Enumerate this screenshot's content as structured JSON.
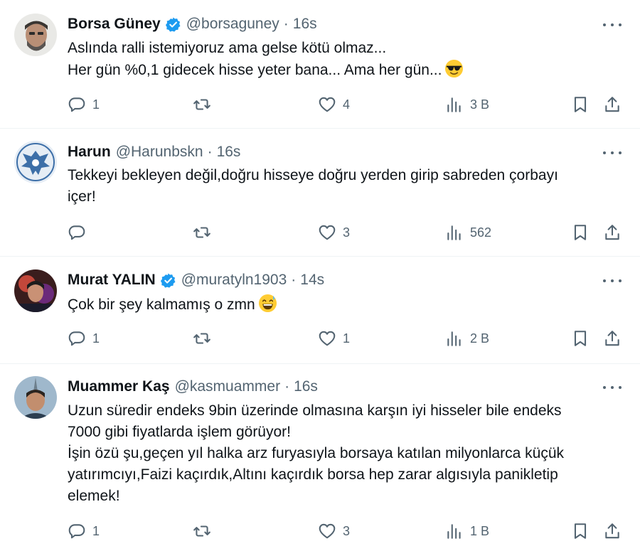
{
  "tweets": [
    {
      "name": "Borsa Güney",
      "verified": true,
      "handle": "@borsaguney",
      "time": "16s",
      "lines": [
        "Aslında ralli istemiyoruz ama gelse kötü olmaz...",
        "Her gün %0,1 gidecek hisse yeter bana... Ama her gün..."
      ],
      "emoji": "sunglasses-emoji",
      "replies": "1",
      "reposts": "",
      "likes": "4",
      "views": "3 B"
    },
    {
      "name": "Harun",
      "verified": false,
      "handle": "@Harunbskn",
      "time": "16s",
      "lines": [
        "Tekkeyi bekleyen değil,doğru hisseye doğru yerden girip sabreden çorbayı",
        "içer!"
      ],
      "replies": "",
      "reposts": "",
      "likes": "3",
      "views": "562"
    },
    {
      "name": "Murat YALIN",
      "verified": true,
      "handle": "@muratyln1903",
      "time": "14s",
      "lines": [
        "Çok bir şey kalmamış o zmn"
      ],
      "emoji": "grinning-sweat-emoji",
      "replies": "1",
      "reposts": "",
      "likes": "1",
      "views": "2 B"
    },
    {
      "name": "Muammer Kaş",
      "verified": false,
      "handle": "@kasmuammer",
      "time": "16s",
      "lines": [
        "Uzun süredir endeks 9bin üzerinde olmasına karşın iyi hisseler bile endeks",
        "7000 gibi fiyatlarda işlem görüyor!",
        "İşin özü şu,geçen yıl halka arz furyasıyla borsaya katılan milyonlarca küçük",
        "yatırımcıyı,Faizi kaçırdık,Altını kaçırdık borsa hep zarar algısıyla panikletip",
        "elemek!"
      ],
      "replies": "1",
      "reposts": "",
      "likes": "3",
      "views": "1 B"
    }
  ],
  "dot": "·",
  "icons": {
    "verified": "verified-badge-icon",
    "reply": "reply-icon",
    "repost": "repost-icon",
    "like": "like-icon",
    "views": "views-icon",
    "bookmark": "bookmark-icon",
    "share": "share-icon",
    "more": "more-icon"
  },
  "colors": {
    "text": "#0f1419",
    "secondary": "#536471",
    "verified": "#1d9bf0",
    "divider": "#eff3f4"
  }
}
